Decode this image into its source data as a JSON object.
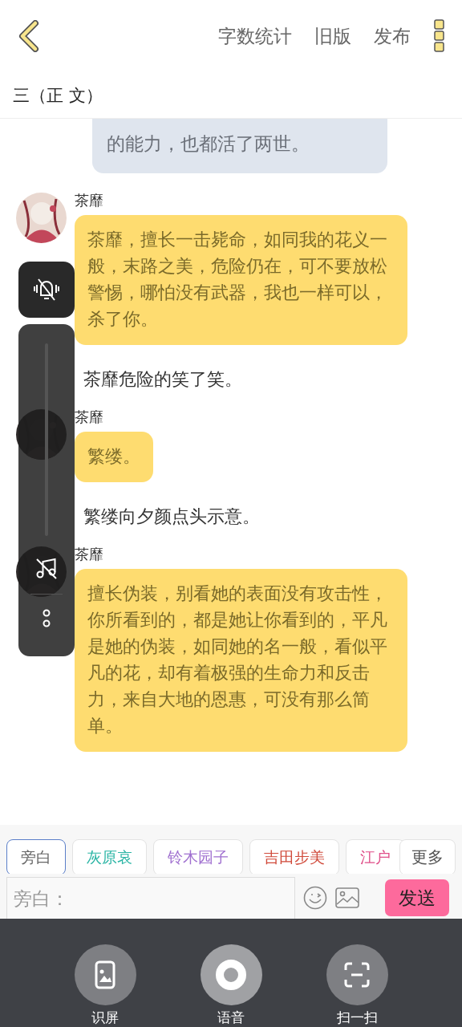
{
  "header": {
    "actions": [
      "字数统计",
      "旧版",
      "发布"
    ]
  },
  "chapter_title": "三（正 文）",
  "messages": [
    {
      "kind": "bubble-right",
      "text": "的能力，也都活了两世。"
    },
    {
      "kind": "bubble",
      "name": "茶靡",
      "text": "茶靡，擅长一击毙命，如同我的花义一般，末路之美，危险仍在，可不要放松警惕，哪怕没有武器，我也一样可以，杀了你。"
    },
    {
      "kind": "narration",
      "text": "茶靡危险的笑了笑。"
    },
    {
      "kind": "bubble",
      "name": "茶靡",
      "text": "繁缕。"
    },
    {
      "kind": "narration",
      "text": "繁缕向夕颜点头示意。"
    },
    {
      "kind": "bubble",
      "name": "茶靡",
      "text": "擅长伪装，别看她的表面没有攻击性，你所看到的，都是她让你看到的，平凡是她的伪装，如同她的名一般，看似平凡的花，却有着极强的生命力和反击力，来自大地的恩惠，可没有那么简单。"
    }
  ],
  "roles": [
    {
      "label": "旁白",
      "color": "#666666",
      "selected": true
    },
    {
      "label": "灰原哀",
      "color": "#2bb5a5",
      "selected": false
    },
    {
      "label": "铃木园子",
      "color": "#a070d0",
      "selected": false
    },
    {
      "label": "吉田步美",
      "color": "#d04a3a",
      "selected": false
    },
    {
      "label": "江户",
      "color": "#e0508a",
      "selected": false
    }
  ],
  "more_button": "更多",
  "input": {
    "placeholder": "旁白："
  },
  "send_button": "发送",
  "quick_actions": [
    {
      "kind": "screen",
      "label": "识屏"
    },
    {
      "kind": "voice",
      "label": "语音"
    },
    {
      "kind": "scan",
      "label": "扫一扫"
    }
  ]
}
